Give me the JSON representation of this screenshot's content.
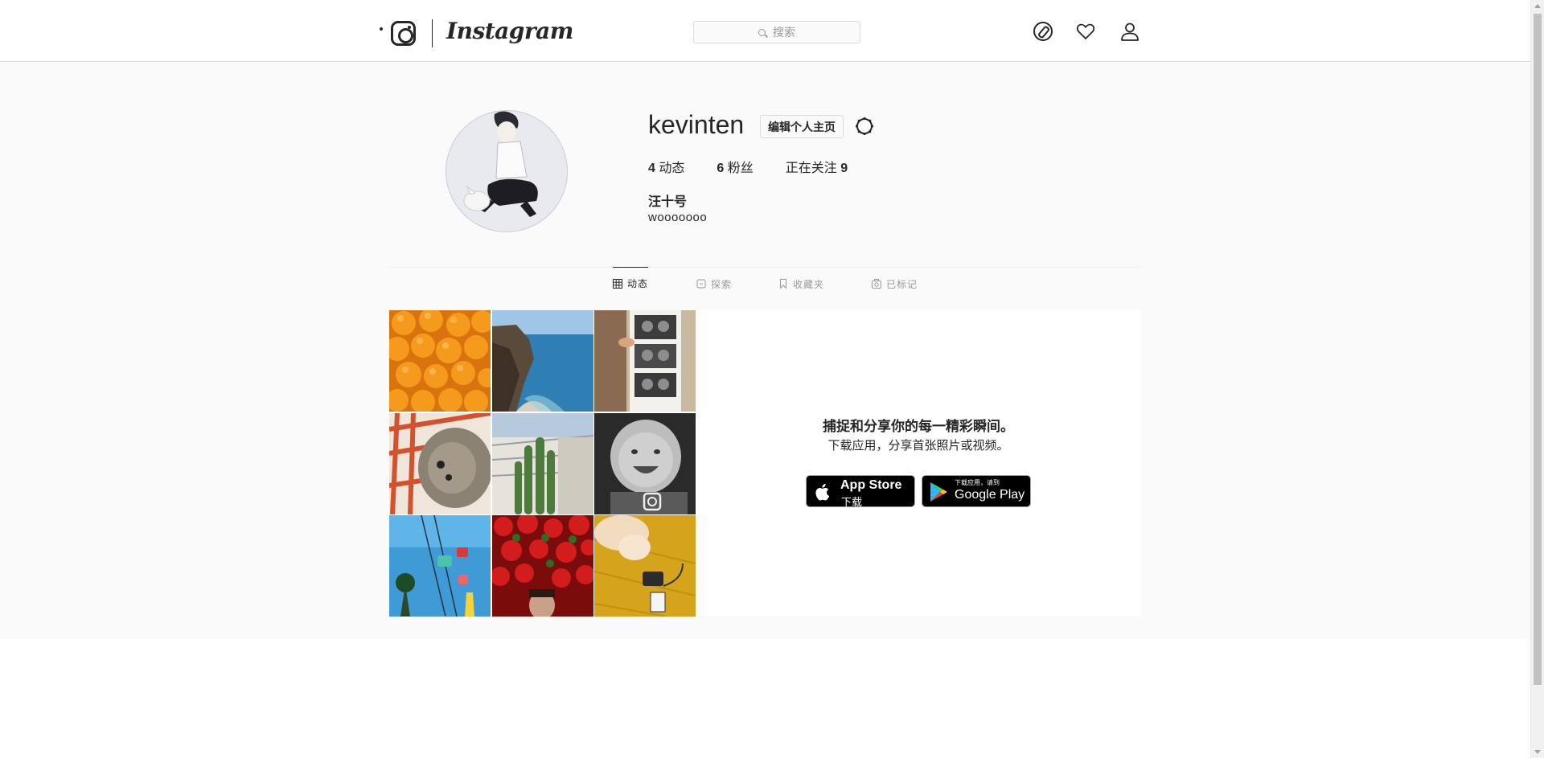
{
  "header": {
    "brand": "Instagram",
    "search_placeholder": "搜索",
    "icons": [
      "compass-icon",
      "heart-icon",
      "person-icon"
    ]
  },
  "profile": {
    "username": "kevinten",
    "edit_label": "编辑个人主页",
    "stats": {
      "posts_count": "4",
      "posts_label": "动态",
      "followers_count": "6",
      "followers_label": "粉丝",
      "following_label": "正在关注",
      "following_count": "9"
    },
    "full_name": "汪十号",
    "bio": "wooooooo"
  },
  "tabs": [
    {
      "label": "动态",
      "active": true,
      "icon": "grid-icon"
    },
    {
      "label": "探索",
      "active": false,
      "icon": "explore-icon"
    },
    {
      "label": "收藏夹",
      "active": false,
      "icon": "bookmark-icon"
    },
    {
      "label": "已标记",
      "active": false,
      "icon": "tagged-icon"
    }
  ],
  "promo": {
    "title": "捕捉和分享你的每一精彩瞬间。",
    "subtitle": "下载应用，分享首张照片或视频。",
    "appstore_big": "App Store",
    "appstore_small": "下载",
    "gplay_small": "下载应用，请到",
    "gplay_big": "Google Play"
  },
  "colors": {
    "text": "#262626",
    "muted": "#999999",
    "border": "#dbdbdb",
    "page_bg": "#fafafa"
  }
}
